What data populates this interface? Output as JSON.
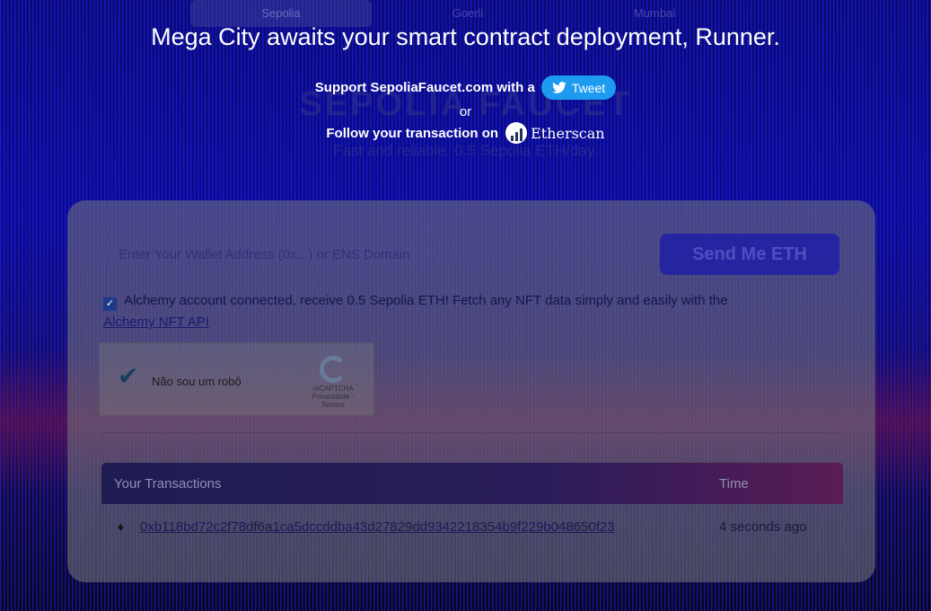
{
  "tabs": [
    {
      "label": "Sepolia",
      "active": true
    },
    {
      "label": "Goerli",
      "active": false
    },
    {
      "label": "Mumbai",
      "active": false
    }
  ],
  "background_hero": {
    "title": "SEPOLIA FAUCET",
    "subtitle": "Fast and reliable. 0.5 Sepolia ETH/day."
  },
  "overlay": {
    "headline": "Mega City awaits your smart contract deployment, Runner.",
    "support_text": "Support SepoliaFaucet.com with a",
    "tweet_label": "Tweet",
    "or_text": "or",
    "follow_text": "Follow your transaction on",
    "etherscan_label": "Etherscan"
  },
  "form": {
    "wallet_placeholder": "Enter Your Wallet Address (0x...) or ENS Domain",
    "send_button": "Send Me ETH",
    "alchemy_checked": true,
    "alchemy_text": "Alchemy account connected, receive 0.5 Sepolia ETH! Fetch any NFT data simply and easily with the",
    "alchemy_link": "Alchemy NFT API"
  },
  "captcha": {
    "label": "Não sou um robô",
    "brand": "reCAPTCHA",
    "footer": "Privacidade - Termos"
  },
  "transactions": {
    "header_tx": "Your Transactions",
    "header_time": "Time",
    "rows": [
      {
        "hash": "0xb118bd72c2f78df6a1ca5dccddba43d27829dd9342218354b9f229b048650f23",
        "time": "4 seconds ago"
      }
    ]
  },
  "colors": {
    "tweet_blue": "#1d9bf0",
    "background_blue": "#0b0b8a",
    "send_button": "#1919aa"
  }
}
